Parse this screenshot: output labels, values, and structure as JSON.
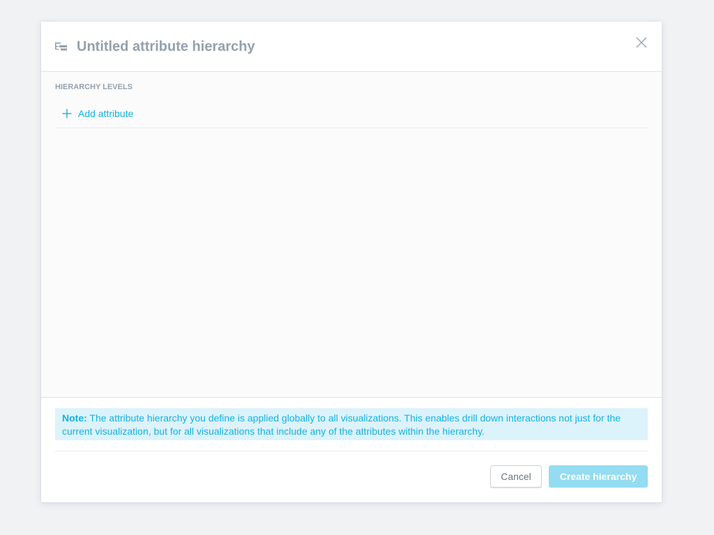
{
  "dialog": {
    "title": "Untitled attribute hierarchy",
    "title_icon": "hierarchy-icon",
    "close_icon": "close-icon"
  },
  "levels": {
    "section_label": "HIERARCHY LEVELS",
    "add_label": "Add attribute",
    "add_icon": "plus-icon"
  },
  "note": {
    "prefix": "Note:",
    "text": "The attribute hierarchy you define is applied globally to all visualizations. This enables drill down interactions not just for the current visualization, but for all visualizations that include any of the attributes within the hierarchy."
  },
  "footer": {
    "cancel_label": "Cancel",
    "create_label": "Create hierarchy"
  },
  "colors": {
    "accent": "#14b2e2",
    "muted_text": "#94a1ad",
    "note_bg": "#dcf3fb",
    "primary_disabled": "#94dcf1"
  }
}
